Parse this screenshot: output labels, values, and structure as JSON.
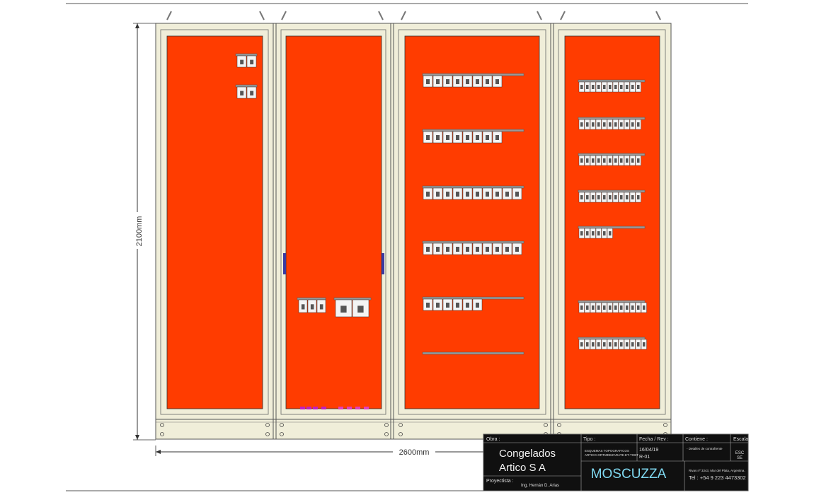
{
  "dimensions": {
    "height_label": "2100mm",
    "width_label": "2600mm"
  },
  "colors": {
    "panel_red": "#ff3c00",
    "frame": "#f0eed9",
    "frame_stroke": "#555555",
    "title_block": "#101010",
    "brand_text": "#7fd8f0"
  },
  "cabinets": [
    {
      "id": "cabinet-1",
      "device_groups": [
        "small-breaker-pair"
      ]
    },
    {
      "id": "cabinet-2",
      "device_groups": [
        "main-breaker-group"
      ]
    },
    {
      "id": "cabinet-3",
      "device_rows": 6
    },
    {
      "id": "cabinet-4",
      "device_rows": 7
    }
  ],
  "title_block": {
    "obra_label": "Obra :",
    "obra_line1": "Congelados",
    "obra_line2": "Artico S A",
    "proyectista_label": "Proyectista :",
    "proyectista": "Ing. Hernán D. Arias",
    "tipo_label": "Tipo :",
    "tipo_line1": "ESQUEMAS TOPOGRAFICOS",
    "tipo_line2": "ARTICO-ORTIZDEZARATE-ET-TGBT",
    "fecha_label": "Fecha / Rev :",
    "fecha": "16/04/19",
    "rev": "R-01",
    "contiene_label": "Contiene :",
    "contiene": "- Detalles de contrafrente",
    "escala_label": "Escala",
    "escala_line1": "ESC",
    "escala_line2": "SE",
    "brand": "MOSCUZZA",
    "address": "Rivas nº 3343, Mar del Plata, Argentina.",
    "phone": "Tel : +54 9 223 4473302"
  }
}
